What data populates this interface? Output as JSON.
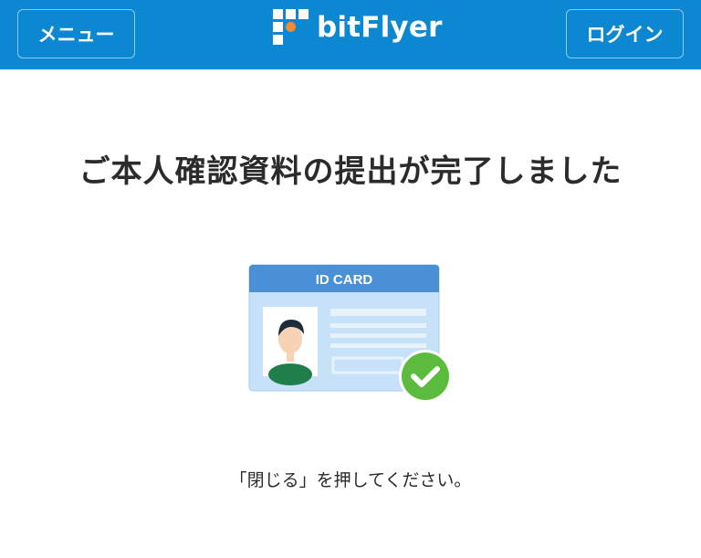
{
  "header": {
    "menu_label": "メニュー",
    "login_label": "ログイン",
    "brand": "bitFlyer",
    "bg_color": "#0b88d1",
    "logo_accent_color": "#f08a35"
  },
  "main": {
    "title": "ご本人確認資料の提出が完了しました",
    "card_label": "ID CARD",
    "instruction": "「閉じる」を押してください。"
  },
  "icons": {
    "logo": "bitflyer-logo-icon",
    "card": "id-card-icon",
    "check": "check-icon"
  },
  "colors": {
    "check_green": "#5bbb3c",
    "card_blue": "#4a90d6",
    "card_body": "#bfdcf6"
  }
}
